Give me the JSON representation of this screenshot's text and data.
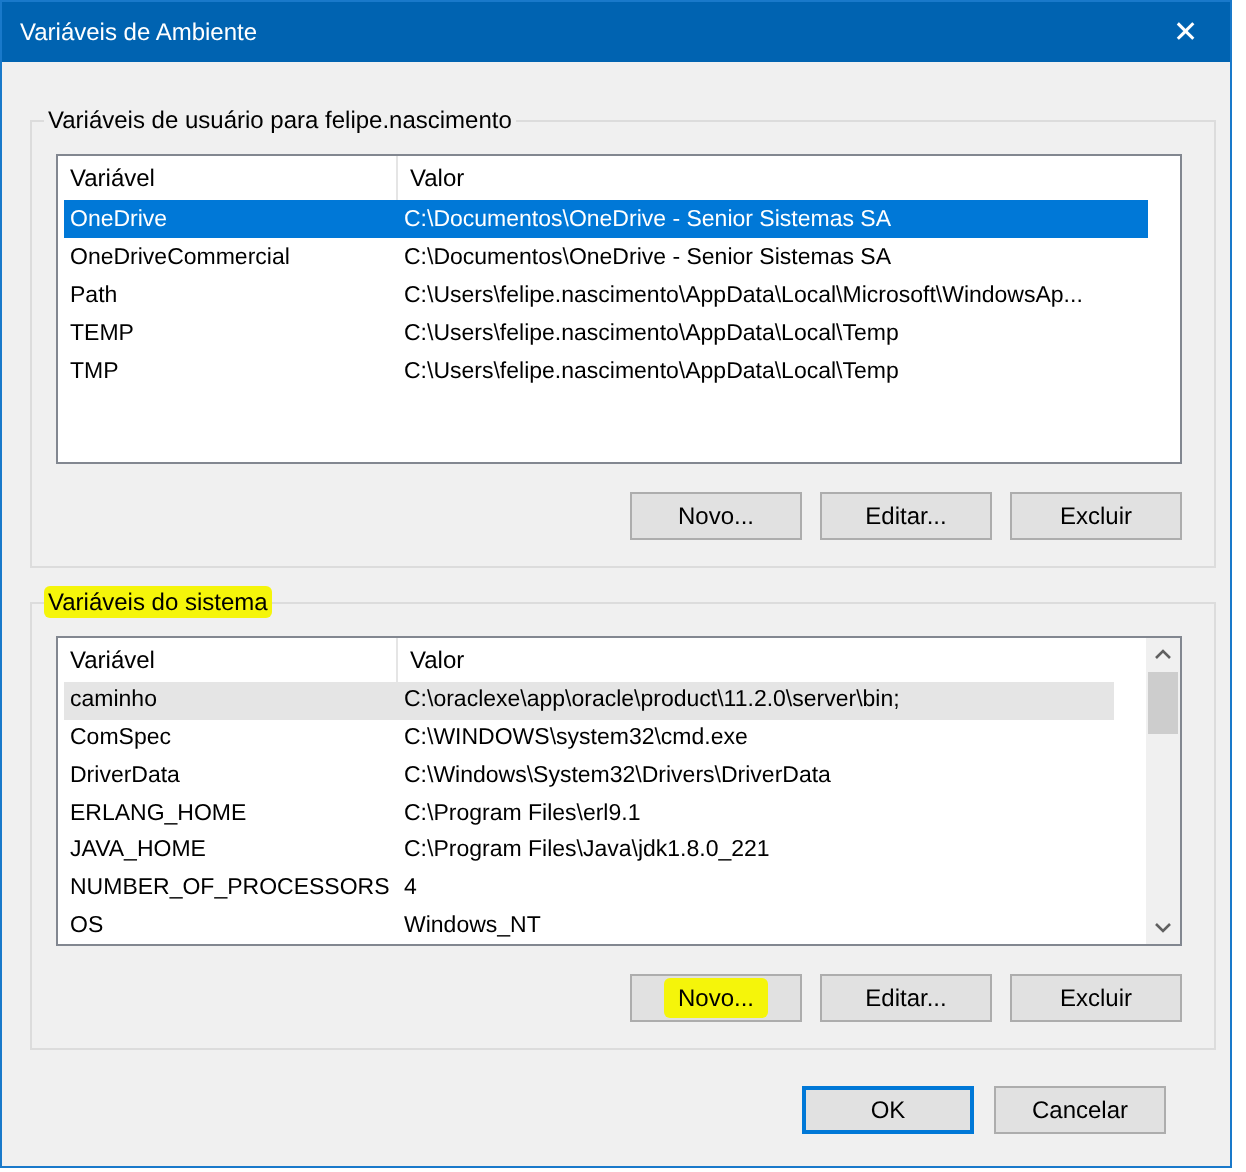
{
  "window": {
    "title": "Variáveis de Ambiente",
    "close": "✕"
  },
  "groups": [
    {
      "title": "Variáveis de usuário para felipe.nascimento",
      "highlighted": false,
      "focused": true,
      "scrollbar": false,
      "columns": [
        "Variável",
        "Valor"
      ],
      "rows": [
        {
          "name": "OneDrive",
          "value": "C:\\Documentos\\OneDrive - Senior Sistemas SA",
          "selected": true
        },
        {
          "name": "OneDriveCommercial",
          "value": "C:\\Documentos\\OneDrive - Senior Sistemas SA",
          "selected": false
        },
        {
          "name": "Path",
          "value": "C:\\Users\\felipe.nascimento\\AppData\\Local\\Microsoft\\WindowsAp...",
          "selected": false
        },
        {
          "name": "TEMP",
          "value": "C:\\Users\\felipe.nascimento\\AppData\\Local\\Temp",
          "selected": false
        },
        {
          "name": "TMP",
          "value": "C:\\Users\\felipe.nascimento\\AppData\\Local\\Temp",
          "selected": false
        }
      ],
      "buttons": [
        {
          "label": "Novo...",
          "highlighted": false
        },
        {
          "label": "Editar...",
          "highlighted": false
        },
        {
          "label": "Excluir",
          "highlighted": false
        }
      ]
    },
    {
      "title": "Variáveis do sistema",
      "highlighted": true,
      "focused": false,
      "scrollbar": true,
      "columns": [
        "Variável",
        "Valor"
      ],
      "rows": [
        {
          "name": "caminho",
          "value": "C:\\oraclexe\\app\\oracle\\product\\11.2.0\\server\\bin;",
          "selected": true
        },
        {
          "name": "ComSpec",
          "value": "C:\\WINDOWS\\system32\\cmd.exe",
          "selected": false
        },
        {
          "name": "DriverData",
          "value": "C:\\Windows\\System32\\Drivers\\DriverData",
          "selected": false
        },
        {
          "name": "ERLANG_HOME",
          "value": "C:\\Program Files\\erl9.1",
          "selected": false
        },
        {
          "name": "JAVA_HOME",
          "value": "C:\\Program Files\\Java\\jdk1.8.0_221",
          "selected": false
        },
        {
          "name": "NUMBER_OF_PROCESSORS",
          "value": "4",
          "selected": false
        },
        {
          "name": "OS",
          "value": "Windows_NT",
          "selected": false
        }
      ],
      "buttons": [
        {
          "label": "Novo...",
          "highlighted": true
        },
        {
          "label": "Editar...",
          "highlighted": false
        },
        {
          "label": "Excluir",
          "highlighted": false
        }
      ]
    }
  ],
  "footer_buttons": [
    {
      "label": "OK",
      "default": true
    },
    {
      "label": "Cancelar",
      "default": false
    }
  ]
}
